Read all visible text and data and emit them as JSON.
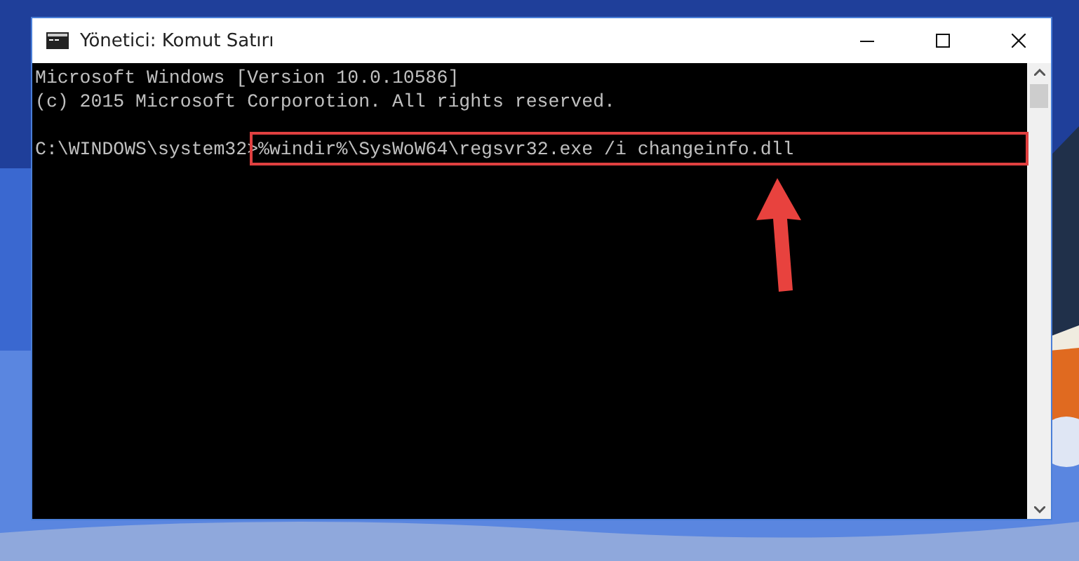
{
  "window": {
    "title": "Yönetici: Komut Satırı"
  },
  "console": {
    "lines": [
      {
        "kind": "output",
        "text": "Microsoft Windows [Version 10.0.10586]"
      },
      {
        "kind": "output",
        "text": "(c) 2015 Microsoft Corporotion. All rights reserved."
      },
      {
        "kind": "command",
        "prompt": "C:\\WINDOWS\\system32>",
        "command": "%windir%\\SysWoW64\\regsvr32.exe /i changeinfo.dll",
        "highlighted": true
      }
    ]
  }
}
